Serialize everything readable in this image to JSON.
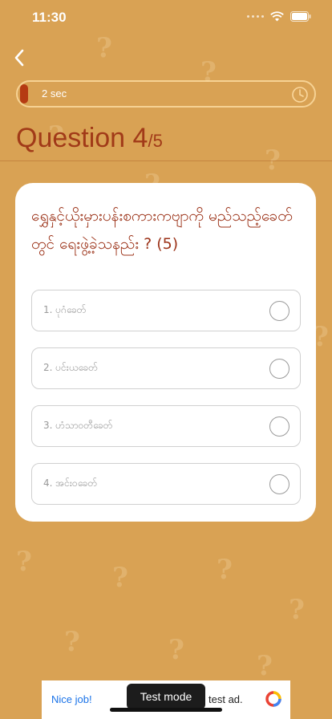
{
  "status_bar": {
    "time": "11:30"
  },
  "timer": {
    "label": "2 sec",
    "progress": 0.02
  },
  "header": {
    "question_label": "Question 4",
    "question_total": "/5"
  },
  "question": {
    "text": "ရွှေနှင့်ယိုးမှားပန်းစကားကဗျာကို မည်သည့်ခေတ်တွင် ရေးဖွဲ့ခဲ့သနည်း ? (5)"
  },
  "options": [
    {
      "label": "1. ပုဂံခေတ်"
    },
    {
      "label": "2. ပင်းယခေတ်"
    },
    {
      "label": "3. ဟံသာဝတီခေတ်"
    },
    {
      "label": "4. အင်းဝခေတ်"
    }
  ],
  "ad": {
    "left_text": "Nice job!",
    "right_text": "test ad.",
    "badge": "Test mode"
  },
  "colors": {
    "background": "#d9a254",
    "accent": "#a13a18",
    "timer_fill": "#b53a12"
  }
}
